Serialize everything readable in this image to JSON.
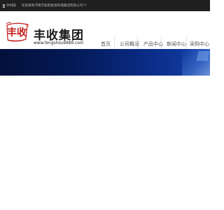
{
  "topbar": {
    "mobile_label": "手机版",
    "welcome_text": "欢迎来到河南丰收新能源车辆集团有限公司!!!"
  },
  "logo": {
    "mark_text": "丰收",
    "sub_text": "fengshou",
    "registered": "®",
    "brand_name": "丰收集团",
    "url": "www.fengshou8888.com"
  },
  "nav": {
    "items": [
      {
        "label": "首页"
      },
      {
        "label": "公司概况"
      },
      {
        "label": "产品中心"
      },
      {
        "label": "新闻中心"
      },
      {
        "label": "采购中心"
      }
    ]
  },
  "colors": {
    "topbar_bg": "#1f1f1f",
    "brand_red": "#c0201f",
    "banner_blue": "#041a56"
  }
}
